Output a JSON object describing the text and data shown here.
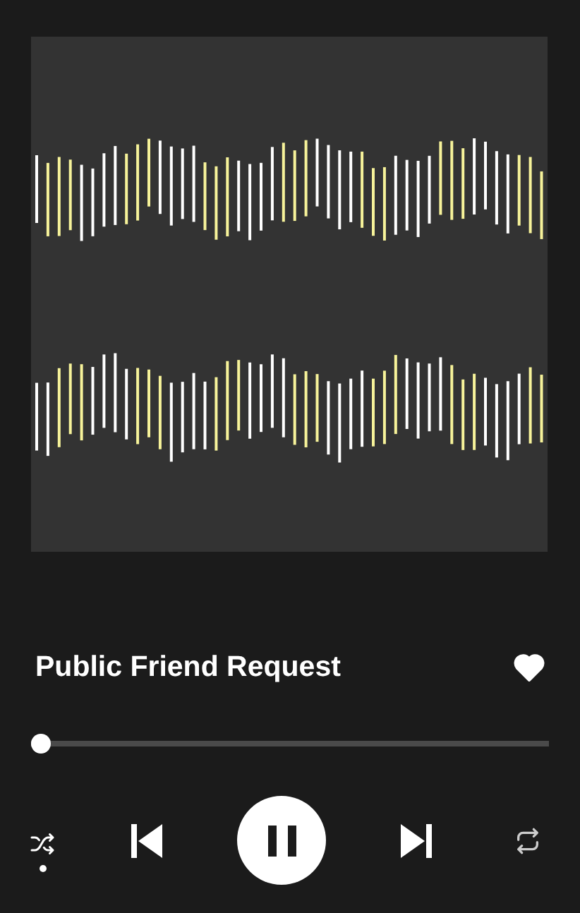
{
  "track": {
    "title": "Public Friend Request",
    "liked": true
  },
  "progress": {
    "level": 0.02
  },
  "controls": {
    "shuffle": true,
    "playing": true
  }
}
